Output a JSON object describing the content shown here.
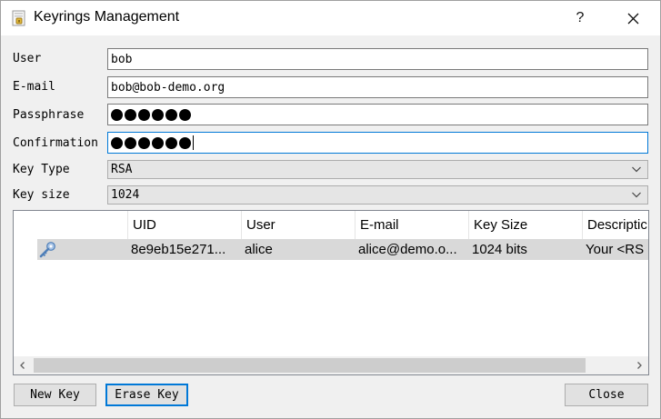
{
  "window": {
    "title": "Keyrings Management",
    "help_label": "?",
    "close_label": "✕",
    "icons": {
      "app": "keyring-app-icon",
      "help": "help-icon",
      "close": "close-icon"
    }
  },
  "form": {
    "user": {
      "label": "User",
      "value": "bob"
    },
    "email": {
      "label": "E-mail",
      "value": "bob@bob-demo.org"
    },
    "passphrase": {
      "label": "Passphrase",
      "masked_length": 6
    },
    "confirmation": {
      "label": "Confirmation",
      "masked_length": 6
    },
    "key_type": {
      "label": "Key Type",
      "value": "RSA"
    },
    "key_size": {
      "label": "Key size",
      "value": "1024"
    }
  },
  "table": {
    "columns": [
      "UID",
      "User",
      "E-mail",
      "Key Size",
      "Descriptic"
    ],
    "rows": [
      {
        "icon": "key-icon",
        "uid": "8e9eb15e271...",
        "user": "alice",
        "email": "alice@demo.o...",
        "key_size": "1024 bits",
        "description": "Your <RS"
      }
    ]
  },
  "buttons": {
    "new_key": "New Key",
    "erase_key": "Erase Key",
    "close": "Close"
  },
  "colors": {
    "accent": "#0078d7",
    "selected_row": "#d9d9d9",
    "window_bg": "#f0f0f0"
  }
}
